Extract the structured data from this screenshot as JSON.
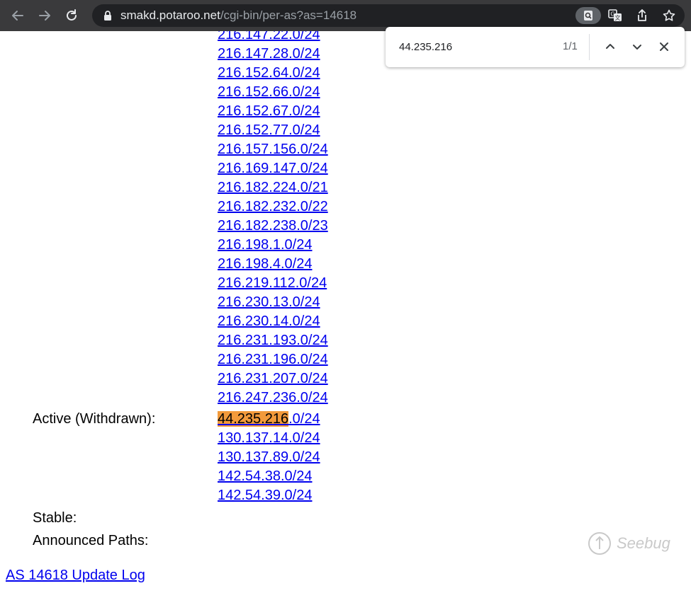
{
  "browser": {
    "url_host": "smakd.potaroo.net",
    "url_path": "/cgi-bin/per-as?as=14618"
  },
  "find_bar": {
    "query": "44.235.216",
    "count": "1/1"
  },
  "prefixes_top": [
    "216.147.22.0/24",
    "216.147.28.0/24",
    "216.152.64.0/24",
    "216.152.66.0/24",
    "216.152.67.0/24",
    "216.152.77.0/24",
    "216.157.156.0/24",
    "216.169.147.0/24",
    "216.182.224.0/21",
    "216.182.232.0/22",
    "216.182.238.0/23",
    "216.198.1.0/24",
    "216.198.4.0/24",
    "216.219.112.0/24",
    "216.230.13.0/24",
    "216.230.14.0/24",
    "216.231.193.0/24",
    "216.231.196.0/24",
    "216.231.207.0/24",
    "216.247.236.0/24"
  ],
  "active_withdrawn": {
    "label": "Active (Withdrawn):",
    "first_highlight": "44.235.216",
    "first_rest": ".0/24",
    "others": [
      "130.137.14.0/24",
      "130.137.89.0/24",
      "142.54.38.0/24",
      "142.54.39.0/24"
    ]
  },
  "stable_label": "Stable:",
  "announced_paths_label": "Announced Paths:",
  "update_log_link": "AS 14618 Update Log",
  "watermark": "Seebug",
  "colors": {
    "link": "#0000ee",
    "find_highlight": "#f29a3b",
    "toolbar": "#3a3a3c"
  }
}
